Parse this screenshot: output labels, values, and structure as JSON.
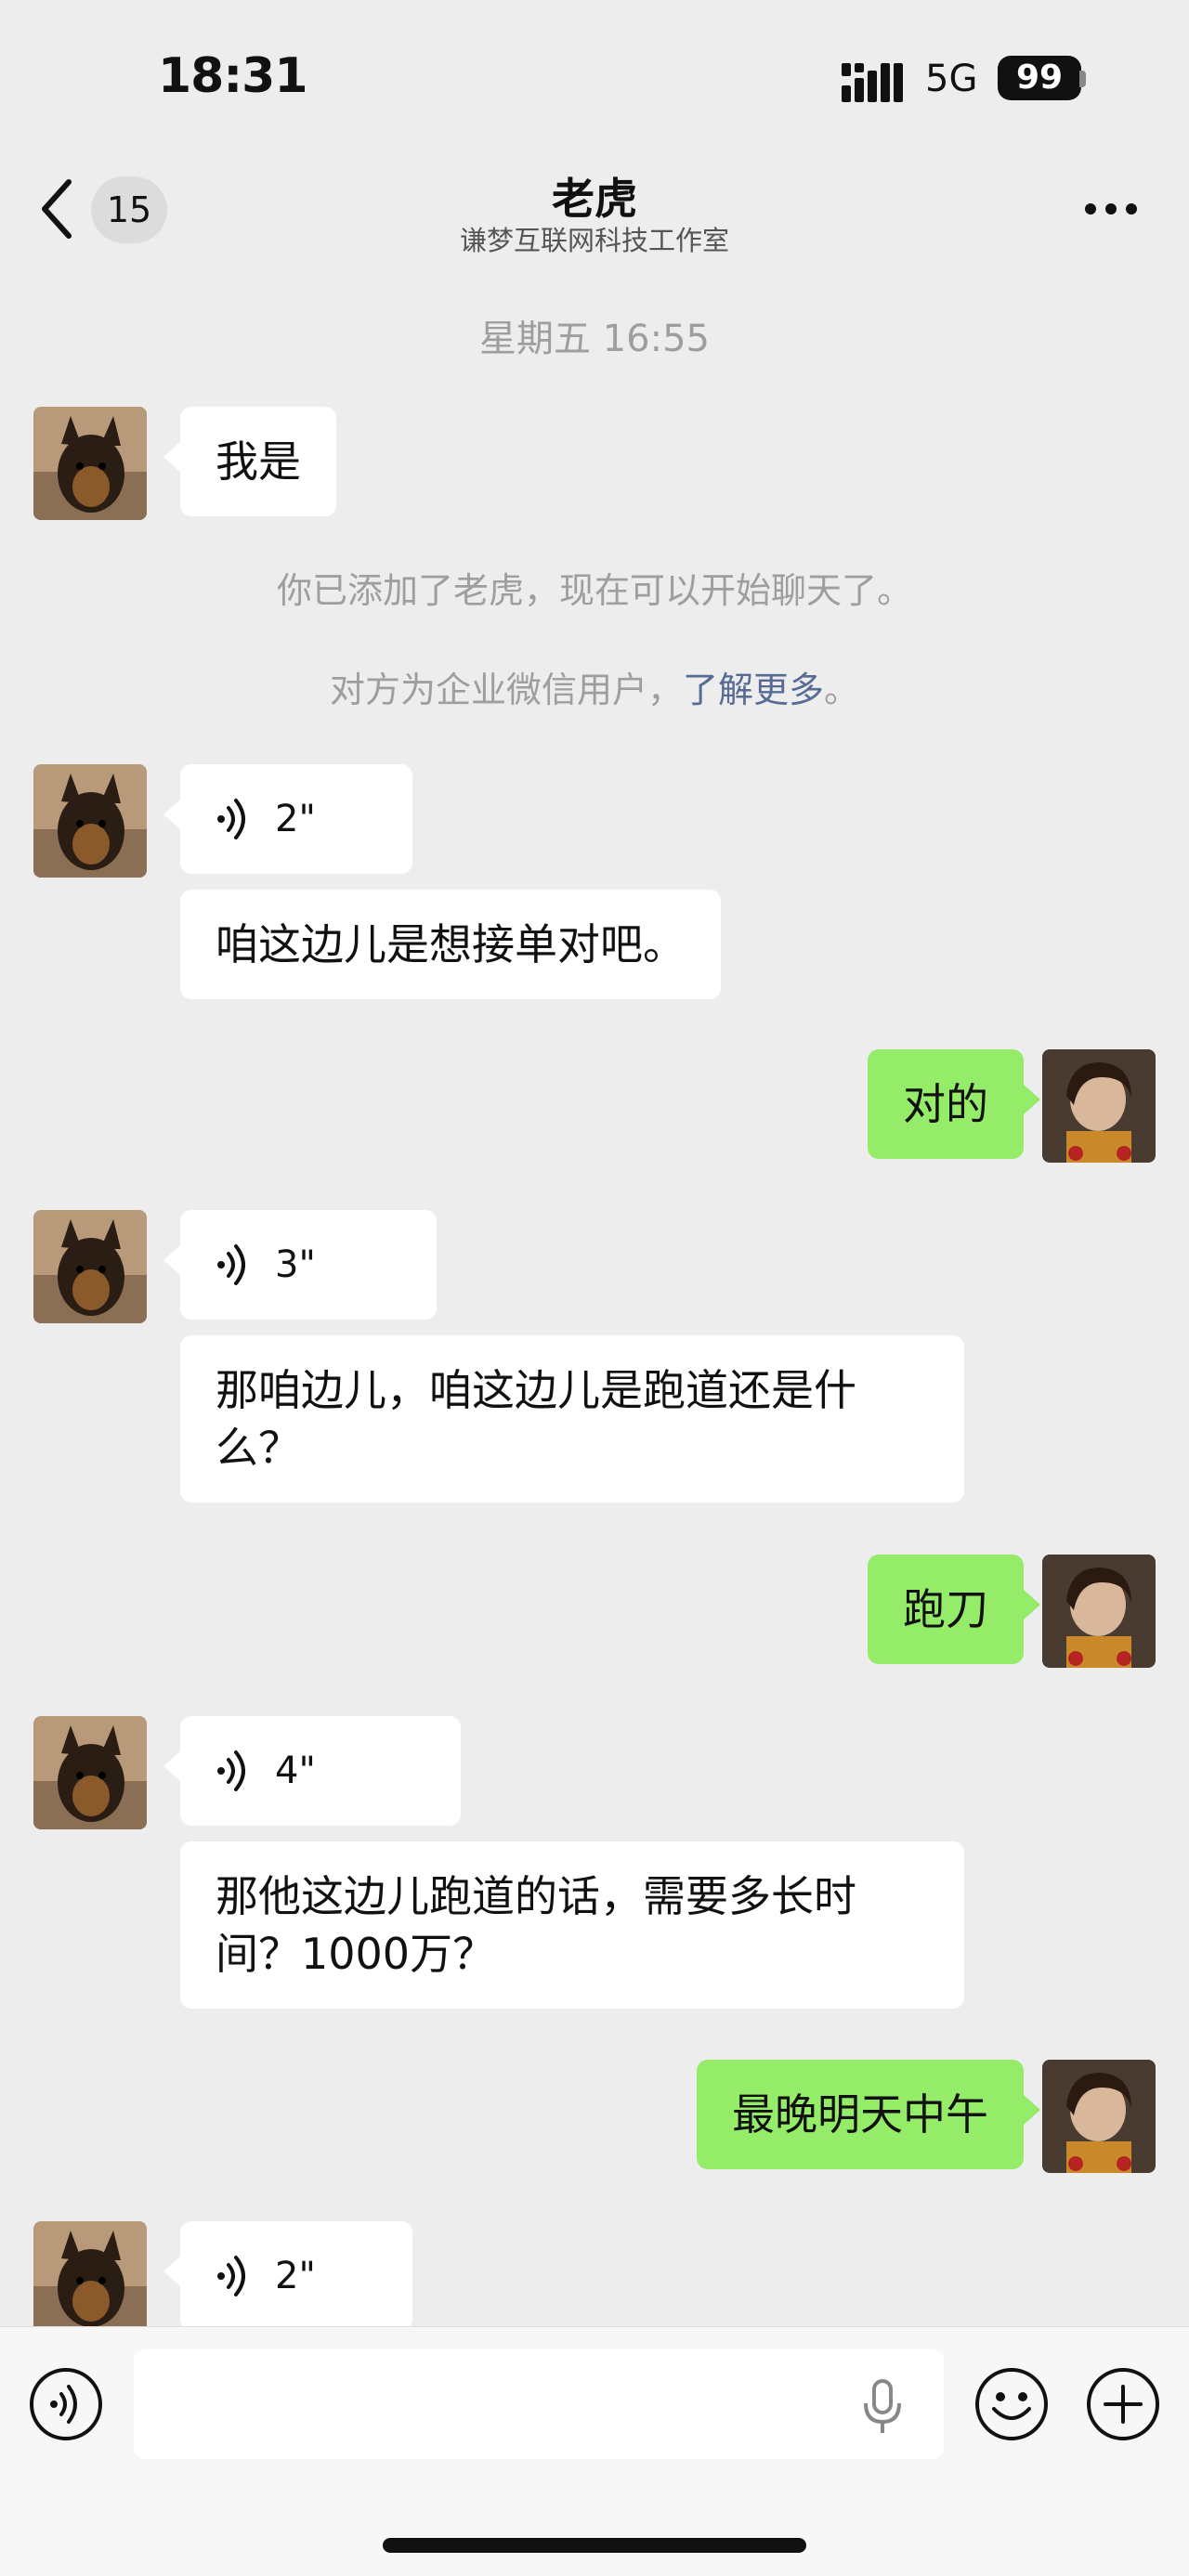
{
  "status_bar": {
    "time": "18:31",
    "network": "5G",
    "battery": "99"
  },
  "nav": {
    "unread_count": "15",
    "title": "老虎",
    "subtitle": "谦梦互联网科技工作室"
  },
  "messages": {
    "timestamp": "星期五 16:55",
    "m1": "我是",
    "sys_added": "你已添加了老虎，现在可以开始聊天了。",
    "sys_enterprise": "对方为企业微信用户，",
    "sys_link": "了解更多",
    "sys_period": "。",
    "v1": "2\"",
    "m2": "咱这边儿是想接单对吧。",
    "me1": "对的",
    "v2": "3\"",
    "m3_line1": "那咱边儿，咱这边儿是跑道还是什",
    "m3_line2": "么？",
    "me2": "跑刀",
    "v3": "4\"",
    "m4_line1": "那他这边儿跑道的话，需要多长时",
    "m4_line2": "间？1000万？",
    "me3": "最晚明天中午",
    "v4": "2\""
  },
  "icons": {
    "back": "chevron-left-icon",
    "more": "ellipsis-icon",
    "voice": "voice-wave-icon",
    "voice_input": "voice-input-icon",
    "mic": "microphone-icon",
    "emoji": "emoji-icon",
    "plus": "plus-icon"
  },
  "colors": {
    "background": "#ededed",
    "my_bubble": "#95ec69",
    "their_bubble": "#ffffff",
    "link": "#576b95"
  }
}
